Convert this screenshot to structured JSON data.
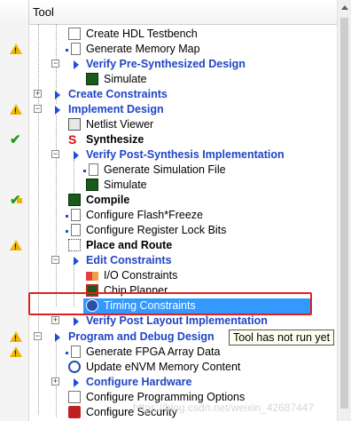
{
  "header": {
    "title": "Tool"
  },
  "tree": [
    {
      "label": "Create HDL Testbench",
      "status": ""
    },
    {
      "label": "Generate Memory Map",
      "status": "warning"
    },
    {
      "label": "Verify Pre-Synthesized Design",
      "status": ""
    },
    {
      "label": "Simulate",
      "status": ""
    },
    {
      "label": "Create Constraints",
      "status": ""
    },
    {
      "label": "Implement Design",
      "status": "warning"
    },
    {
      "label": "Netlist Viewer",
      "status": ""
    },
    {
      "label": "Synthesize",
      "status": "success"
    },
    {
      "label": "Verify Post-Synthesis Implementation",
      "status": ""
    },
    {
      "label": "Generate Simulation File",
      "status": ""
    },
    {
      "label": "Simulate",
      "status": ""
    },
    {
      "label": "Compile",
      "status": "success-warning"
    },
    {
      "label": "Configure Flash*Freeze",
      "status": ""
    },
    {
      "label": "Configure Register Lock Bits",
      "status": ""
    },
    {
      "label": "Place and Route",
      "status": "warning"
    },
    {
      "label": "Edit Constraints",
      "status": ""
    },
    {
      "label": "I/O Constraints",
      "status": ""
    },
    {
      "label": "Chip Planner",
      "status": ""
    },
    {
      "label": "Timing Constraints",
      "status": "",
      "selected": true
    },
    {
      "label": "Verify Post Layout Implementation",
      "status": ""
    },
    {
      "label": "Program and Debug Design",
      "status": "warning"
    },
    {
      "label": "Generate FPGA Array Data",
      "status": "warning"
    },
    {
      "label": "Update eNVM Memory Content",
      "status": ""
    },
    {
      "label": "Configure Hardware",
      "status": ""
    },
    {
      "label": "Configure Programming Options",
      "status": ""
    },
    {
      "label": "Configure Security",
      "status": ""
    }
  ],
  "tooltip": "Tool has not run yet",
  "watermark": "https://blog.csdn.net/weixin_42687447"
}
